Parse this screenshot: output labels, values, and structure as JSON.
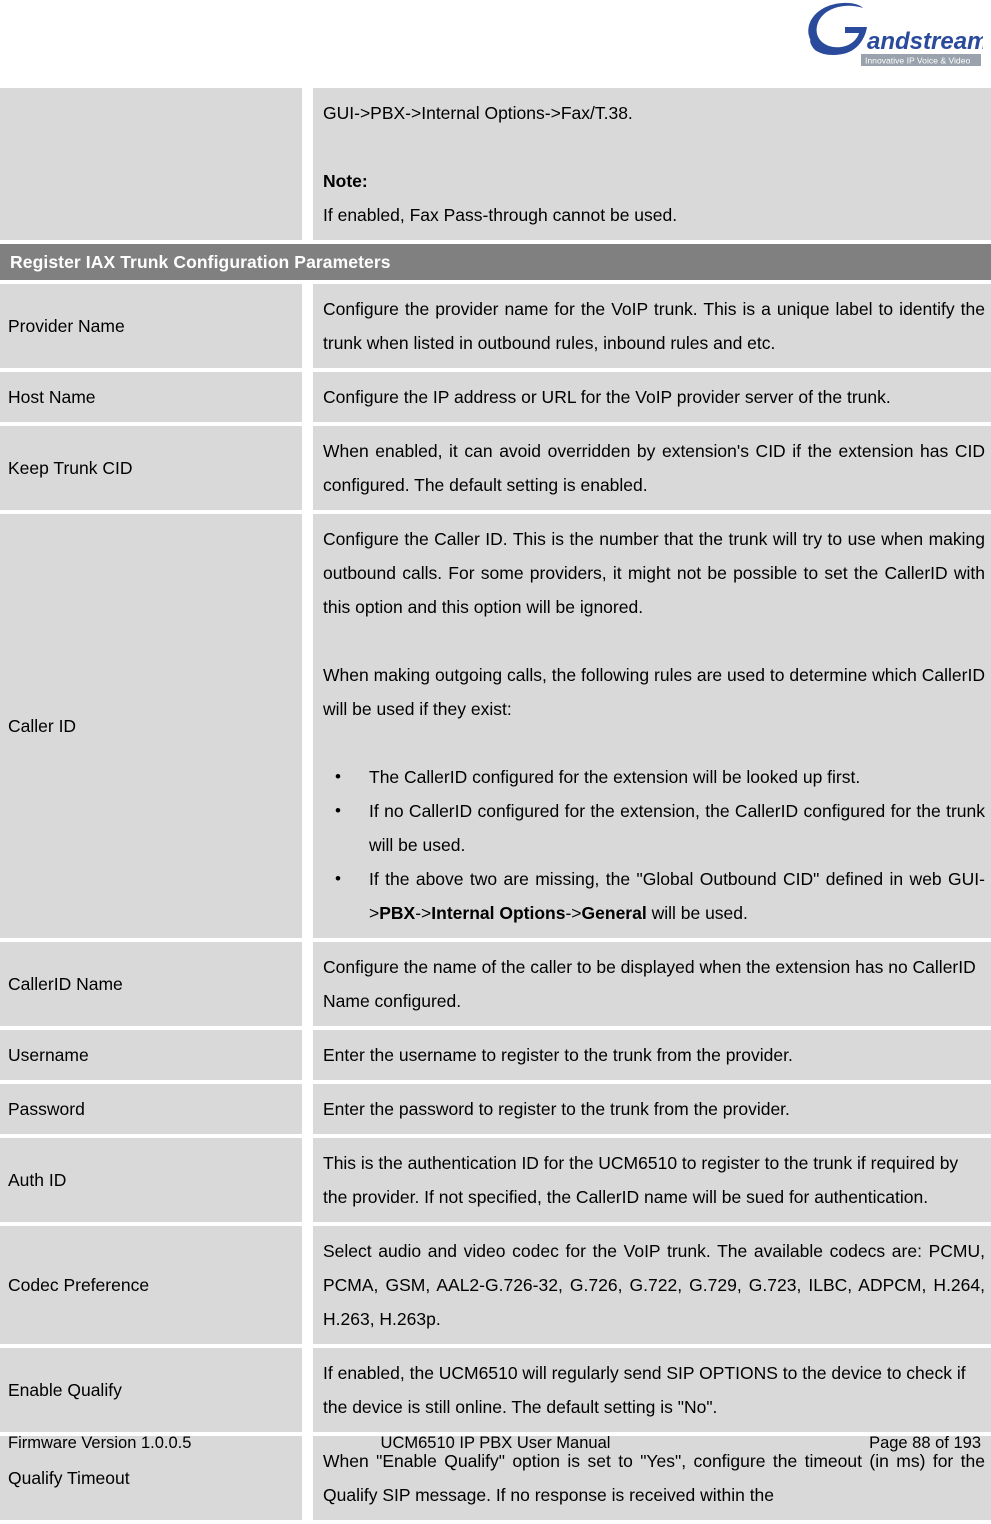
{
  "header": {
    "logo_name": "Grandstream",
    "logo_tagline": "Innovative IP Voice & Video"
  },
  "colors": {
    "cell_background": "#d9d9d9",
    "section_bar_background": "#808080",
    "section_bar_text": "#ffffff",
    "page_background": "#ffffff",
    "logo_blue": "#1f3a93"
  },
  "table": {
    "continued_row": {
      "label": "",
      "line1": "GUI->PBX->Internal Options->Fax/T.38.",
      "note_heading": "Note:",
      "note_text": "If enabled, Fax Pass-through cannot be used."
    },
    "section_bar": "Register IAX Trunk Configuration Parameters",
    "rows": [
      {
        "label": "Provider Name",
        "desc": "Configure the provider name for the VoIP trunk. This is a unique label to identify the trunk when listed in outbound rules, inbound rules and etc."
      },
      {
        "label": "Host Name",
        "desc": "Configure the IP address or URL for the VoIP provider server of the trunk."
      },
      {
        "label": "Keep Trunk CID",
        "desc": "When enabled, it can avoid overridden by extension's CID if the extension has CID configured. The default setting is enabled."
      },
      {
        "label": "Caller ID",
        "para1": "Configure the Caller ID. This is the number that the trunk will try to use when making outbound calls. For some providers, it might not be possible to set the CallerID with this option and this option will be ignored.",
        "para2": "When making outgoing calls, the following rules are used to determine which CallerID will be used if they exist:",
        "bullets": [
          {
            "text": "The CallerID configured for the extension will be looked up first."
          },
          {
            "text": "If no CallerID configured for the extension, the CallerID configured for the trunk will be used."
          },
          {
            "prefix": "If the above two are missing, the \"Global Outbound CID\" defined in web GUI->",
            "bold1": "PBX",
            "mid1": "->",
            "bold2": "Internal Options",
            "mid2": "->",
            "bold3": "General",
            "suffix": " will be used."
          }
        ]
      },
      {
        "label": "CallerID Name",
        "desc": "Configure the name of the caller to be displayed when the extension has no CallerID Name configured."
      },
      {
        "label": "Username",
        "desc": "Enter the username to register to the trunk from the provider."
      },
      {
        "label": "Password",
        "desc": "Enter the password to register to the trunk from the provider."
      },
      {
        "label": "Auth ID",
        "desc": "This is the authentication ID for the UCM6510 to register to the trunk if required by the provider. If not specified, the CallerID name will be sued for authentication."
      },
      {
        "label": "Codec Preference",
        "desc": "Select audio and video codec for the VoIP trunk. The available codecs are: PCMU, PCMA, GSM, AAL2-G.726-32, G.726, G.722, G.729, G.723, ILBC, ADPCM, H.264, H.263, H.263p."
      },
      {
        "label": "Enable Qualify",
        "desc": "If enabled, the UCM6510 will regularly send SIP OPTIONS to the device to check if the device is still online. The default setting is \"No\"."
      },
      {
        "label": "Qualify Timeout",
        "desc": "When \"Enable Qualify\" option is set to \"Yes\", configure the timeout (in ms) for the Qualify SIP message. If no response is received within the"
      }
    ]
  },
  "footer": {
    "left": "Firmware Version 1.0.0.5",
    "center": "UCM6510 IP PBX User Manual",
    "right": "Page 88 of 193"
  }
}
